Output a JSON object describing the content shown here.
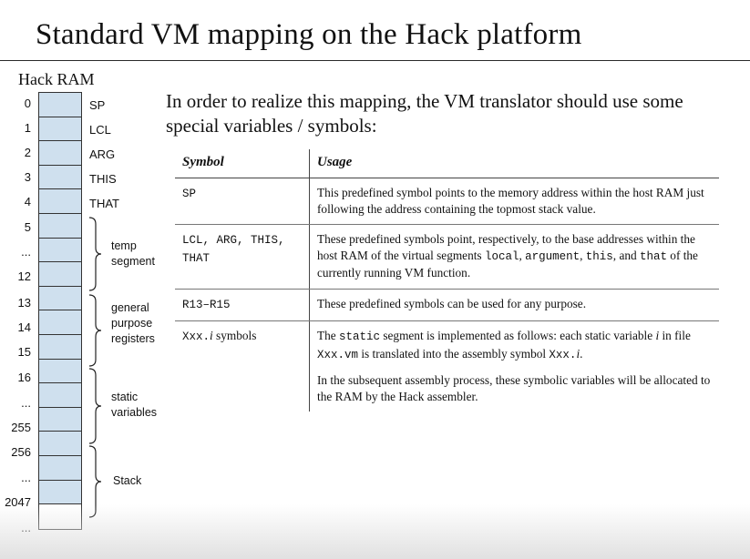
{
  "title": "Standard VM mapping on the Hack platform",
  "ram": {
    "label": "Hack RAM",
    "addresses": [
      "0",
      "1",
      "2",
      "3",
      "4",
      "5",
      "...",
      "12",
      "13",
      "14",
      "15",
      "16",
      "...",
      "255",
      "256",
      "...",
      "2047",
      "..."
    ],
    "registers": [
      "SP",
      "LCL",
      "ARG",
      "THIS",
      "THAT"
    ],
    "segments": [
      {
        "lines": [
          "temp",
          "segment"
        ]
      },
      {
        "lines": [
          "general",
          "purpose",
          "registers"
        ]
      },
      {
        "lines": [
          "static",
          "variables"
        ]
      },
      {
        "lines": [
          "Stack"
        ]
      }
    ]
  },
  "intro": "In order to realize this mapping, the VM translator should use some special variables / symbols:",
  "table": {
    "headers": [
      "Symbol",
      "Usage"
    ],
    "rows": [
      {
        "symbol": "SP",
        "usage": "This predefined symbol points to the memory address within the host RAM just following the address containing the topmost stack value."
      },
      {
        "symbol": "LCL, ARG, THIS, THAT",
        "usage_parts": [
          "These predefined symbols point, respectively, to the base addresses within the host RAM of the virtual segments ",
          "local",
          ", ",
          "argument",
          ", ",
          "this",
          ", and ",
          "that",
          " of the currently running VM function."
        ]
      },
      {
        "symbol": "R13–R15",
        "usage": "These predefined symbols can be used for any purpose."
      },
      {
        "symbol_code": "Xxx.",
        "symbol_italic": "i",
        "symbol_text": " symbols",
        "usage_p1": [
          "The ",
          "static",
          " segment is implemented as follows: each static variable ",
          "i",
          " in file ",
          "Xxx.vm",
          " is translated into the assembly symbol ",
          "Xxx.",
          "i",
          "."
        ],
        "usage_p2": "In the subsequent assembly process, these symbolic variables will be allocated to the RAM by the Hack assembler."
      }
    ]
  }
}
